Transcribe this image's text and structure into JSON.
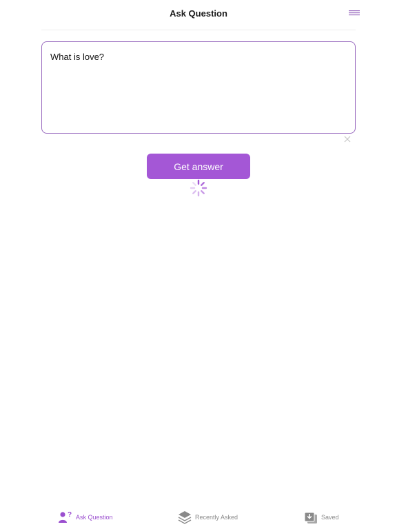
{
  "header": {
    "title": "Ask Question",
    "menu_icon": "hamburger-menu-icon"
  },
  "question": {
    "value": "What is love?",
    "clear_icon": "close-icon"
  },
  "actions": {
    "get_answer_label": "Get answer",
    "loading_icon": "spinner-icon"
  },
  "tabbar": {
    "tabs": [
      {
        "label": "Ask Question",
        "icon": "person-question-icon",
        "active": true
      },
      {
        "label": "Recently Asked",
        "icon": "layers-icon",
        "active": false
      },
      {
        "label": "Saved",
        "icon": "saved-download-icon",
        "active": false
      }
    ]
  },
  "colors": {
    "accent": "#a457d6",
    "accent_border": "#9b6dc0",
    "inactive": "#8a8a8a"
  }
}
